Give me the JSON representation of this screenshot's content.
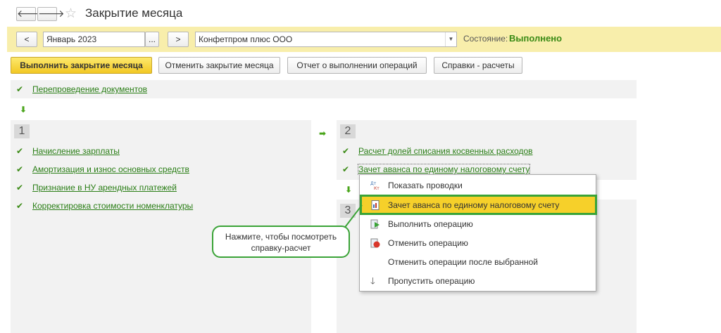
{
  "window": {
    "title": "Закрытие месяца"
  },
  "nav": {
    "back_glyph": "🡐",
    "forward_glyph": "🡒",
    "star_glyph": "☆"
  },
  "toolbar": {
    "prev_label": "<",
    "period_value": "Январь 2023",
    "period_picker_label": "...",
    "next_label": ">",
    "org_value": "Конфетпром плюс ООО",
    "status_label": "Состояние:",
    "status_value": "Выполнено",
    "status_color": "#3a8a15"
  },
  "actions": {
    "run": "Выполнить закрытие месяца",
    "cancel": "Отменить закрытие месяца",
    "report": "Отчет о выполнении операций",
    "refs": "Справки - расчеты"
  },
  "prelude": {
    "link": "Перепроведение документов"
  },
  "group1": {
    "num": "1",
    "items": [
      "Начисление зарплаты",
      "Амортизация и износ основных средств",
      "Признание в НУ арендных платежей",
      "Корректировка стоимости номенклатуры"
    ]
  },
  "group2": {
    "num": "2",
    "items": [
      "Расчет долей списания косвенных расходов",
      "Зачет аванса по единому налоговому счету"
    ]
  },
  "group3": {
    "num": "3"
  },
  "context_menu": {
    "items": [
      {
        "label": "Показать проводки",
        "icon": "dt-kt-icon"
      },
      {
        "label": "Зачет аванса по единому налоговому счету",
        "icon": "report-icon"
      },
      {
        "label": "Выполнить операцию",
        "icon": "execute-icon"
      },
      {
        "label": "Отменить операцию",
        "icon": "cancel-operation-icon"
      },
      {
        "label": "Отменить операции после выбранной",
        "icon": ""
      },
      {
        "label": "Пропустить операцию",
        "icon": "skip-arrow-icon"
      }
    ]
  },
  "callout": {
    "text": "Нажмите, чтобы посмотреть справку-расчет"
  },
  "colors": {
    "accent_yellow": "#f6d02a",
    "link_green": "#2a7e16",
    "highlight_green": "#3aa337"
  }
}
